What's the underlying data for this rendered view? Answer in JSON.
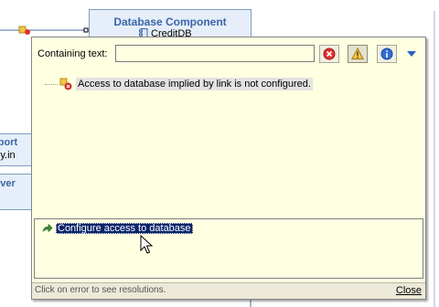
{
  "diagram": {
    "database_node": {
      "title": "Database Component",
      "subtitle": "CreditDB"
    },
    "import_node": {
      "title": "mport",
      "subtitle": "pany.in"
    },
    "server_node": {
      "title": "rver"
    }
  },
  "popup": {
    "filter": {
      "label": "Containing text:",
      "value": "",
      "placeholder": ""
    },
    "toolbar": {
      "errors_icon": "error-filter-icon",
      "warnings_icon": "warning-filter-icon",
      "infos_icon": "info-filter-icon",
      "menu_icon": "view-menu-icon"
    },
    "problems": [
      {
        "icon": "error-overlay-icon",
        "text": "Access to database implied by link is not configured."
      }
    ],
    "resolutions": [
      {
        "icon": "quickfix-arrow-icon",
        "text": "Configure access to database"
      }
    ],
    "status": {
      "text": "Click on error to see resolutions.",
      "close_label": "Close"
    }
  },
  "colors": {
    "popup_background": "#ffffe1",
    "selection": "#0a246a",
    "node_title": "#3a66a8",
    "status_bar": "#ece9d8"
  }
}
